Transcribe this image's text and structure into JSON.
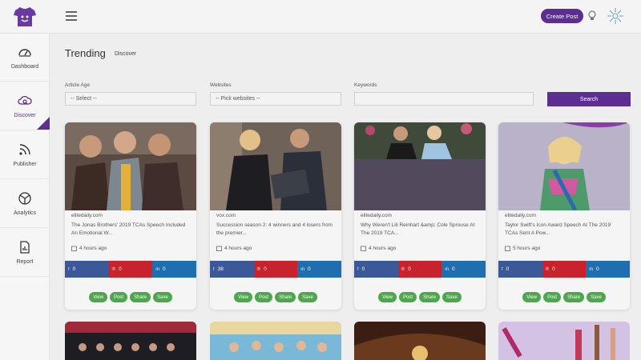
{
  "header": {
    "create_post": "Create Post"
  },
  "sidebar": {
    "items": [
      {
        "label": "Dashboard",
        "icon": "dashboard-icon"
      },
      {
        "label": "Discover",
        "icon": "cloud-search-icon",
        "active": true
      },
      {
        "label": "Publisher",
        "icon": "rss-icon"
      },
      {
        "label": "Analytics",
        "icon": "analytics-icon"
      },
      {
        "label": "Report",
        "icon": "report-icon"
      }
    ]
  },
  "page": {
    "title": "Trending",
    "subtitle": "Discover"
  },
  "filters": {
    "article_age_label": "Article Age",
    "article_age_value": "-- Select --",
    "websites_label": "Websites",
    "websites_value": "-- Pick websites --",
    "keywords_label": "Keywords",
    "keywords_value": "",
    "search_label": "Search"
  },
  "cards": [
    {
      "source": "elitedaily.com",
      "title": "The Jonas Brothers' 2019 TCAs Speech Included An Emotional W...",
      "time": "4 hours ago",
      "fb": "0",
      "pinterest": "0",
      "linkedin": "0"
    },
    {
      "source": "vox.com",
      "title": "Succession season 2: 4 winners and 4 losers from the premier...",
      "time": "4 hours ago",
      "fb": "38",
      "pinterest": "0",
      "linkedin": "0"
    },
    {
      "source": "elitedaily.com",
      "title": "Why Weren't Lili Reinhart &amp; Cole Sprouse At The 2019 TCA...",
      "time": "4 hours ago",
      "fb": "0",
      "pinterest": "0",
      "linkedin": "0"
    },
    {
      "source": "elitedaily.com",
      "title": "Taylor Swift's Icon Award Speech At The 2019 TCAs Sent A Pow...",
      "time": "5 hours ago",
      "fb": "0",
      "pinterest": "0",
      "linkedin": "0"
    }
  ],
  "card_actions": {
    "view": "View",
    "post": "Post",
    "share": "Share",
    "save": "Save"
  },
  "colors": {
    "brand": "#5c2e91",
    "facebook": "#3b5998",
    "pinterest": "#c8232c",
    "linkedin": "#1f6fb0",
    "action_green": "#4ea64e"
  }
}
